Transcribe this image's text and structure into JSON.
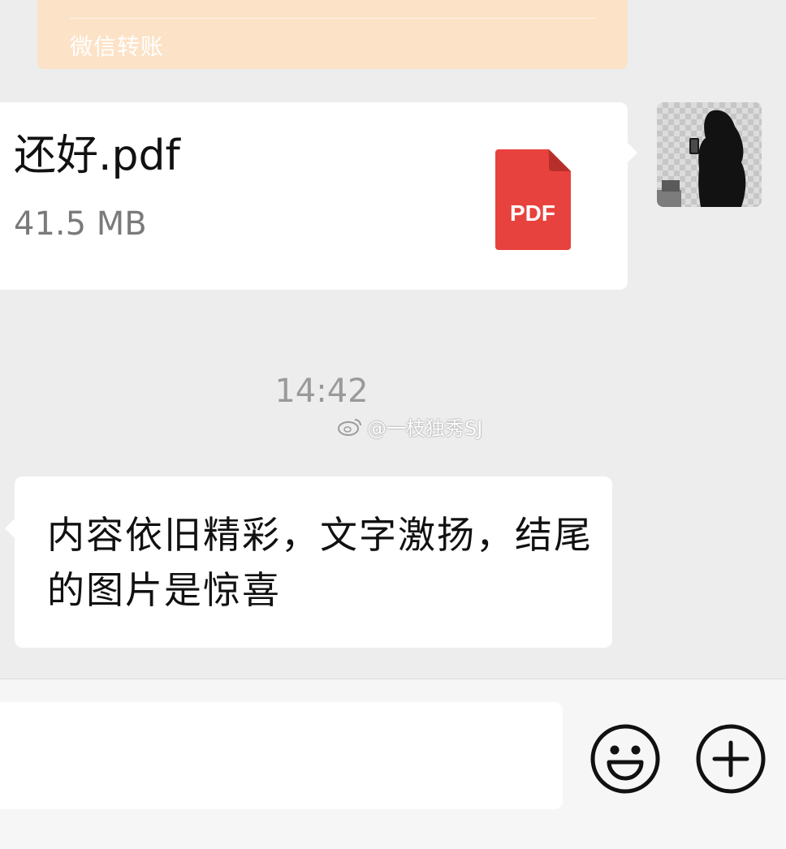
{
  "transfer": {
    "label": "微信转账"
  },
  "file_message": {
    "file_name": "还好.pdf",
    "file_size": "41.5 MB",
    "file_type_label": "PDF",
    "icon": "pdf-file-icon",
    "icon_color": "#e8423e"
  },
  "avatar": {
    "description_icon": "user-avatar"
  },
  "timestamp": "14:42",
  "watermark": {
    "text": "@一枝独秀SJ",
    "icon": "weibo-icon"
  },
  "text_message": {
    "text": "内容依旧精彩，文字激扬，结尾的图片是惊喜"
  },
  "input_bar": {
    "input_value": "",
    "emoji_icon": "smiley-face-icon",
    "plus_icon": "plus-circle-icon"
  },
  "colors": {
    "background": "#ededed",
    "bubble": "#ffffff",
    "transfer_card": "#fce2c6"
  }
}
